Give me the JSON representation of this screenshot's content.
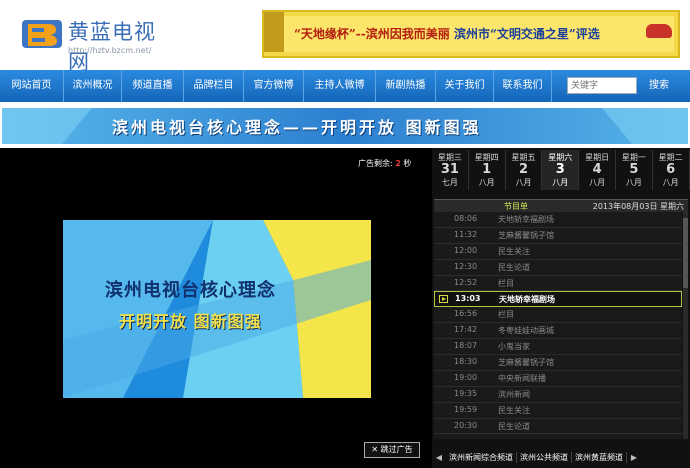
{
  "header": {
    "logo_name": "黄蓝电视网",
    "logo_url": "http://hztv.bzcm.net/",
    "banner": {
      "part1": "“天地缘杯”--滨州因我而美丽",
      "part2": "滨州市“文明交通之星”评选"
    }
  },
  "nav": {
    "items": [
      {
        "label": "网站首页"
      },
      {
        "label": "滨州概况"
      },
      {
        "label": "频道直播"
      },
      {
        "label": "品牌栏目"
      },
      {
        "label": "官方微博"
      },
      {
        "label": "主持人微博"
      },
      {
        "label": "新剧热播"
      },
      {
        "label": "关于我们"
      },
      {
        "label": "联系我们"
      }
    ],
    "search_placeholder": "关键字",
    "search_button": "搜索"
  },
  "slogan": {
    "text": "滨州电视台核心理念——开明开放 图新图强"
  },
  "player": {
    "ad_countdown_label": "广告剩余:",
    "ad_countdown_value": "2",
    "ad_countdown_unit": "秒",
    "ad_line1": "滨州电视台核心理念",
    "ad_line2": "开明开放 图新图强",
    "skip_label": "跳过广告"
  },
  "days": [
    {
      "weekday": "星期三",
      "day": "31",
      "month": "七月"
    },
    {
      "weekday": "星期四",
      "day": "1",
      "month": "八月"
    },
    {
      "weekday": "星期五",
      "day": "2",
      "month": "八月"
    },
    {
      "weekday": "星期六",
      "day": "3",
      "month": "八月"
    },
    {
      "weekday": "星期日",
      "day": "4",
      "month": "八月"
    },
    {
      "weekday": "星期一",
      "day": "5",
      "month": "八月"
    },
    {
      "weekday": "星期二",
      "day": "6",
      "month": "八月"
    }
  ],
  "schedule": {
    "label": "节目单",
    "date": "2013年08月03日 星期六",
    "rows": [
      {
        "time": "08:06",
        "title": "天地轿幸福剧场"
      },
      {
        "time": "11:32",
        "title": "芝麻酱馨锅子馆"
      },
      {
        "time": "12:00",
        "title": "民生关注"
      },
      {
        "time": "12:30",
        "title": "民生论道"
      },
      {
        "time": "12:52",
        "title": "栏目"
      },
      {
        "time": "13:03",
        "title": "天地轿幸福剧场"
      },
      {
        "time": "16:56",
        "title": "栏目"
      },
      {
        "time": "17:42",
        "title": "冬枣娃娃动画城"
      },
      {
        "time": "18:07",
        "title": "小鬼当家"
      },
      {
        "time": "18:30",
        "title": "芝麻酱馨锅子馆"
      },
      {
        "time": "19:00",
        "title": "中央新闻联播"
      },
      {
        "time": "19:35",
        "title": "滨州新闻"
      },
      {
        "time": "19:59",
        "title": "民生关注"
      },
      {
        "time": "20:30",
        "title": "民生论道"
      }
    ]
  },
  "channels": {
    "prev_arrow": "◀",
    "tabs": [
      {
        "label": "滨州新闻综合频道"
      },
      {
        "label": "滨州公共频道"
      },
      {
        "label": "滨州黄蓝频道"
      }
    ],
    "next_arrow": "▶"
  }
}
